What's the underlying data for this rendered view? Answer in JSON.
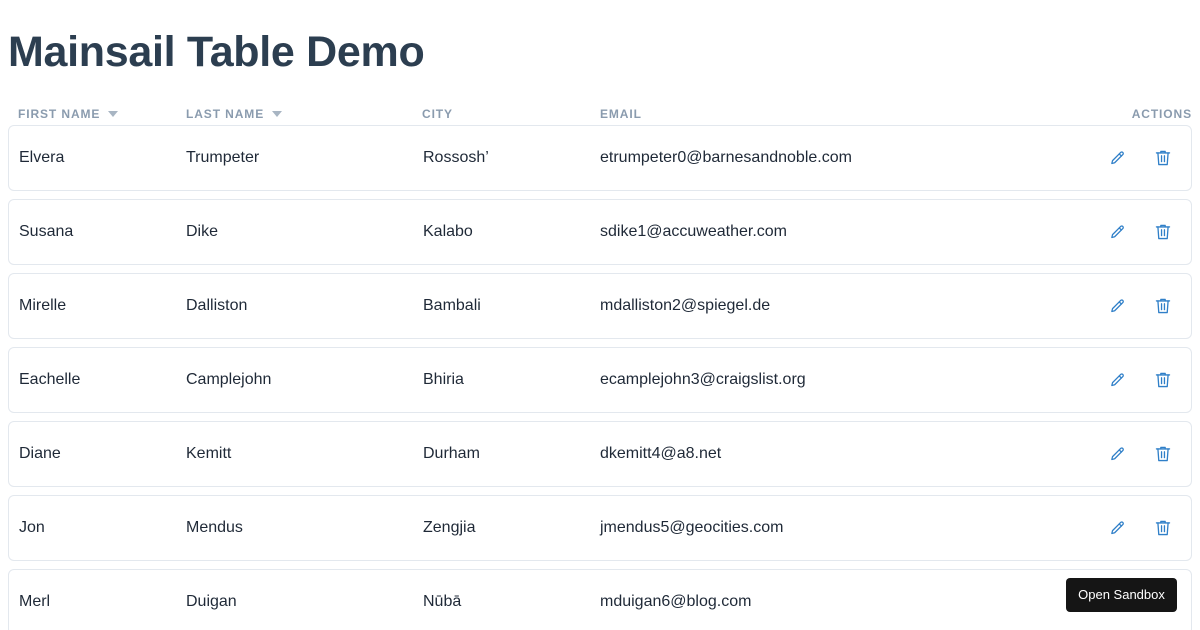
{
  "page": {
    "title": "Mainsail Table Demo"
  },
  "table": {
    "columns": {
      "first_name": "FIRST NAME",
      "last_name": "LAST NAME",
      "city": "CITY",
      "email": "EMAIL",
      "actions": "ACTIONS"
    },
    "sortable_columns": [
      "first_name",
      "last_name"
    ],
    "rows": [
      {
        "first_name": "Elvera",
        "last_name": "Trumpeter",
        "city": "Rossosh’",
        "email": "etrumpeter0@barnesandnoble.com"
      },
      {
        "first_name": "Susana",
        "last_name": "Dike",
        "city": "Kalabo",
        "email": "sdike1@accuweather.com"
      },
      {
        "first_name": "Mirelle",
        "last_name": "Dalliston",
        "city": "Bambali",
        "email": "mdalliston2@spiegel.de"
      },
      {
        "first_name": "Eachelle",
        "last_name": "Camplejohn",
        "city": "Bhiria",
        "email": "ecamplejohn3@craigslist.org"
      },
      {
        "first_name": "Diane",
        "last_name": "Kemitt",
        "city": "Durham",
        "email": "dkemitt4@a8.net"
      },
      {
        "first_name": "Jon",
        "last_name": "Mendus",
        "city": "Zengjia",
        "email": "jmendus5@geocities.com"
      },
      {
        "first_name": "Merl",
        "last_name": "Duigan",
        "city": "Nūbā",
        "email": "mduigan6@blog.com"
      }
    ],
    "row_actions": [
      "pencil-icon",
      "trash-icon"
    ]
  },
  "sandbox": {
    "label": "Open Sandbox"
  },
  "colors": {
    "title": "#2c3e50",
    "header_text": "#8a9bae",
    "action_icon": "#2f7fc8",
    "row_border": "#e3e8ee",
    "sandbox_bg": "#151515"
  }
}
